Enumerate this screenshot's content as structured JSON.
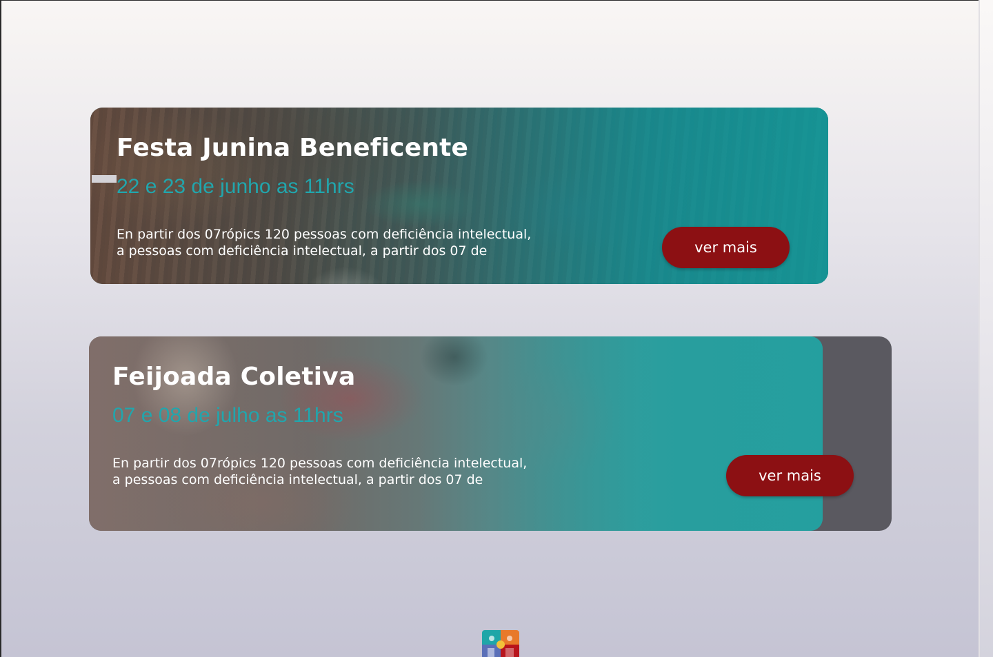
{
  "events": [
    {
      "title": "Festa Junina Beneficente",
      "date": "22 e 23 de junho  as 11hrs",
      "description_line1": "En partir dos 07rópics 120 pessoas com deficiência intelectual,",
      "description_line2": "a  pessoas com deficiência intelectual, a partir dos 07  de",
      "button_label": "ver mais"
    },
    {
      "title": "Feijoada Coletiva",
      "date": "07 e 08 de julho  as 11hrs",
      "description_line1": "En partir dos 07rópics 120 pessoas com deficiência intelectual,",
      "description_line2": "a  pessoas com deficiência intelectual, a partir dos 07  de",
      "button_label": "ver mais"
    }
  ],
  "footer": {
    "logo_icon": "colorful-puzzle-logo-icon"
  },
  "colors": {
    "accent_teal": "#21a6ad",
    "button_red": "#8c1013",
    "title_white": "#ffffff"
  }
}
